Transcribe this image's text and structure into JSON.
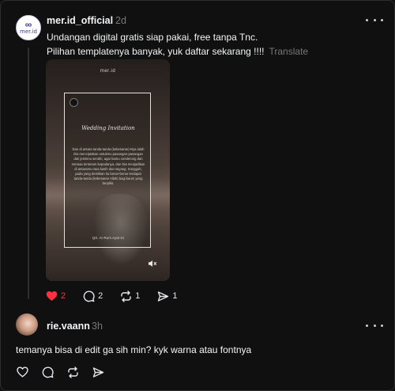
{
  "post": {
    "author": "mer.id_official",
    "avatar_text": "mer.id",
    "time": "2d",
    "caption_line1": "Undangan digital gratis siap pakai, free tanpa Tnc.",
    "caption_line2": "Pilihan templatenya banyak, yuk daftar sekarang !!!!",
    "translate_label": "Translate",
    "media": {
      "brand": "mer.id",
      "script_title": "Wedding Invitation",
      "body_text": "Dan di antara tanda-tanda (kebesaran)-Nya ialah Dia menciptakan untukmu pasangan-pasangan dari jenismu sendiri, agar kamu cenderung dan merasa tenteram kepadanya, dan Dia menjadikan di antaramu rasa kasih dan sayang. Sungguh, pada yang demikian itu benar-benar terdapat tanda-tanda (kebesaran Allah) bagi kaum yang berpikir.",
      "signature": "QS. Ar-Rum Ayat 21"
    },
    "likes": "2",
    "comments": "2",
    "reposts": "1",
    "shares": "1",
    "like_color": "#ff3040"
  },
  "comment": {
    "author": "rie.vaann",
    "time": "3h",
    "text": "temanya bisa di edit ga sih min? kyk warna atau fontnya"
  }
}
